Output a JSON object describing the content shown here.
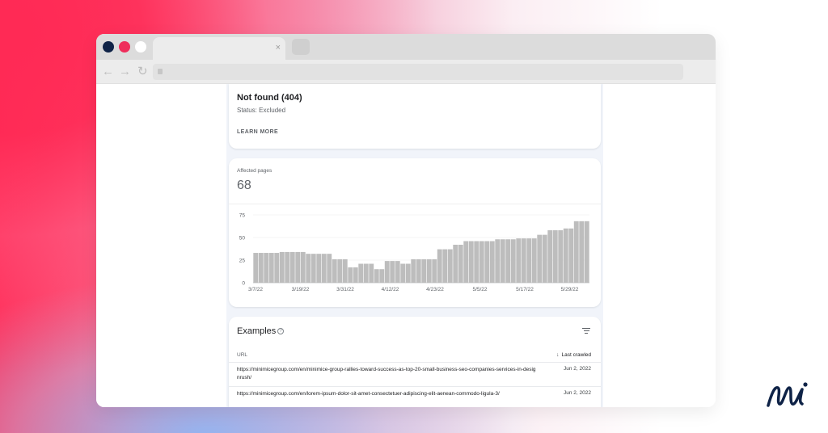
{
  "browser": {
    "tab_close": "×",
    "nav_back": "←",
    "nav_forward": "→",
    "nav_reload": "↻"
  },
  "issue": {
    "title": "Not found (404)",
    "status": "Status: Excluded",
    "learn_more": "LEARN MORE"
  },
  "affected": {
    "label": "Affected pages",
    "value": "68"
  },
  "chart_data": {
    "type": "bar",
    "ylim": [
      0,
      75
    ],
    "yticks": [
      0,
      25,
      50,
      75
    ],
    "xticks": [
      "3/7/22",
      "3/19/22",
      "3/31/22",
      "4/12/22",
      "4/23/22",
      "5/5/22",
      "5/17/22",
      "5/29/22"
    ],
    "values": [
      33,
      33,
      33,
      33,
      33,
      34,
      34,
      34,
      34,
      34,
      32,
      32,
      32,
      32,
      32,
      26,
      26,
      26,
      17,
      17,
      21,
      21,
      21,
      15,
      15,
      24,
      24,
      24,
      21,
      21,
      26,
      26,
      26,
      26,
      26,
      37,
      37,
      37,
      42,
      42,
      46,
      46,
      46,
      46,
      46,
      46,
      48,
      48,
      48,
      48,
      49,
      49,
      49,
      49,
      53,
      53,
      58,
      58,
      58,
      60,
      60,
      68,
      68,
      68
    ],
    "bar_color": "#bdbdbd",
    "grid": true
  },
  "examples": {
    "title": "Examples",
    "help_glyph": "?",
    "col_url": "URL",
    "col_crawled": "Last crawled",
    "sort_arrow": "↓",
    "rows": [
      {
        "url": "https://minimicegroup.com/en/minimice-group-rallies-toward-success-as-top-20-small-business-seo-companies-services-in-designrush/",
        "date": "Jun 2, 2022"
      },
      {
        "url": "https://minimicegroup.com/en/lorem-ipsum-dolor-sit-amet-consectetuer-adipiscing-elit-aenean-commodo-ligula-3/",
        "date": "Jun 2, 2022"
      }
    ]
  },
  "colors": {
    "brand_navy": "#0f2347",
    "brand_pink": "#ef2d5b",
    "bar": "#bdbdbd"
  }
}
